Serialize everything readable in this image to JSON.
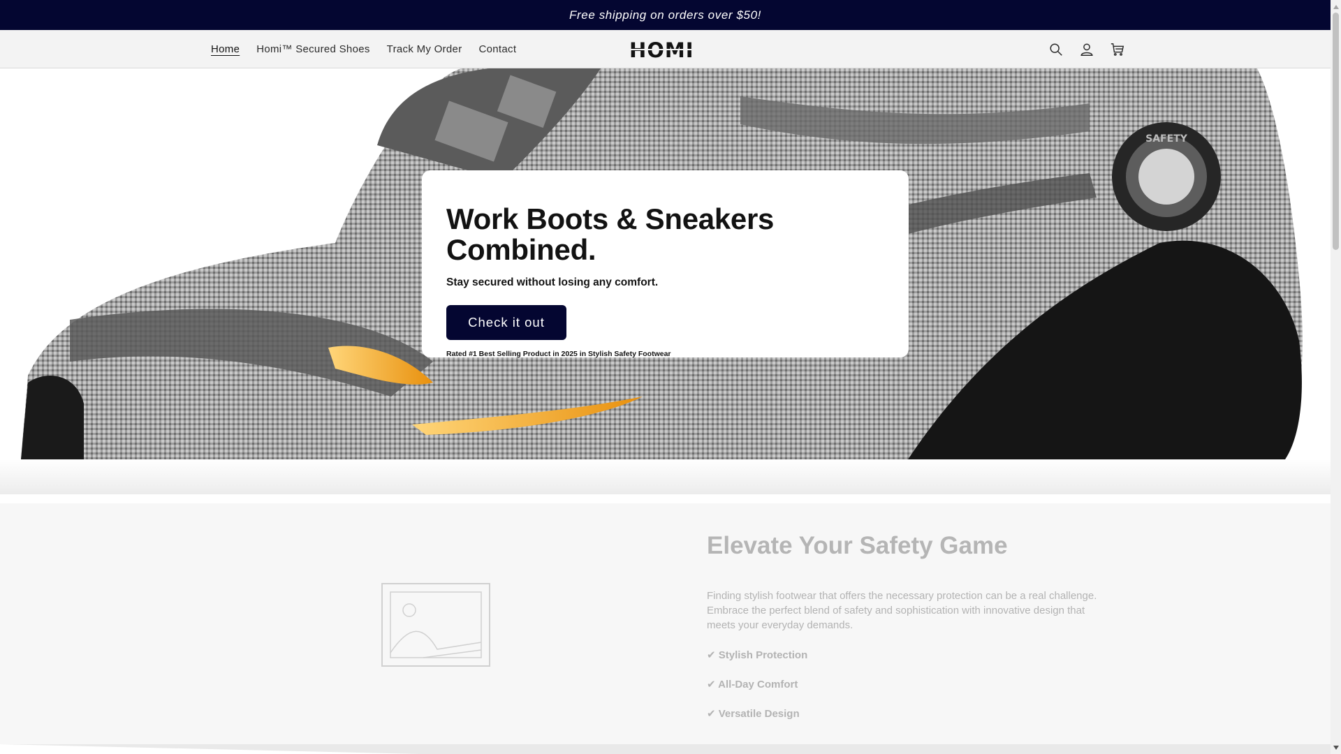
{
  "announcement": {
    "text": "Free shipping on orders over $50!"
  },
  "header": {
    "logo": "HOMI",
    "nav": [
      {
        "label": "Home"
      },
      {
        "label": "Homi™ Secured Shoes"
      },
      {
        "label": "Track My Order"
      },
      {
        "label": "Contact"
      }
    ],
    "icons": [
      "search-icon",
      "account-icon",
      "cart-icon"
    ]
  },
  "hero": {
    "title": "Work Boots & Sneakers Combined.",
    "subtitle": "Stay secured without losing any comfort.",
    "button_label": "Check it out",
    "note": "Rated #1 Best Selling Product in 2025 in Stylish Safety Footwear",
    "badge_text": "SAFETY"
  },
  "section2": {
    "title": "Elevate Your Safety Game",
    "body": "Finding stylish footwear that offers the necessary protection can be a real challenge. Embrace the perfect blend of safety and sophistication with innovative design that meets your everyday demands.",
    "bullets": [
      "✔ Stylish Protection",
      "✔ All-Day Comfort",
      "✔ Versatile Design"
    ]
  },
  "colors": {
    "brand_navy": "#040631",
    "accent_orange": "#f5a623",
    "muted_text": "#b3b3b3"
  }
}
